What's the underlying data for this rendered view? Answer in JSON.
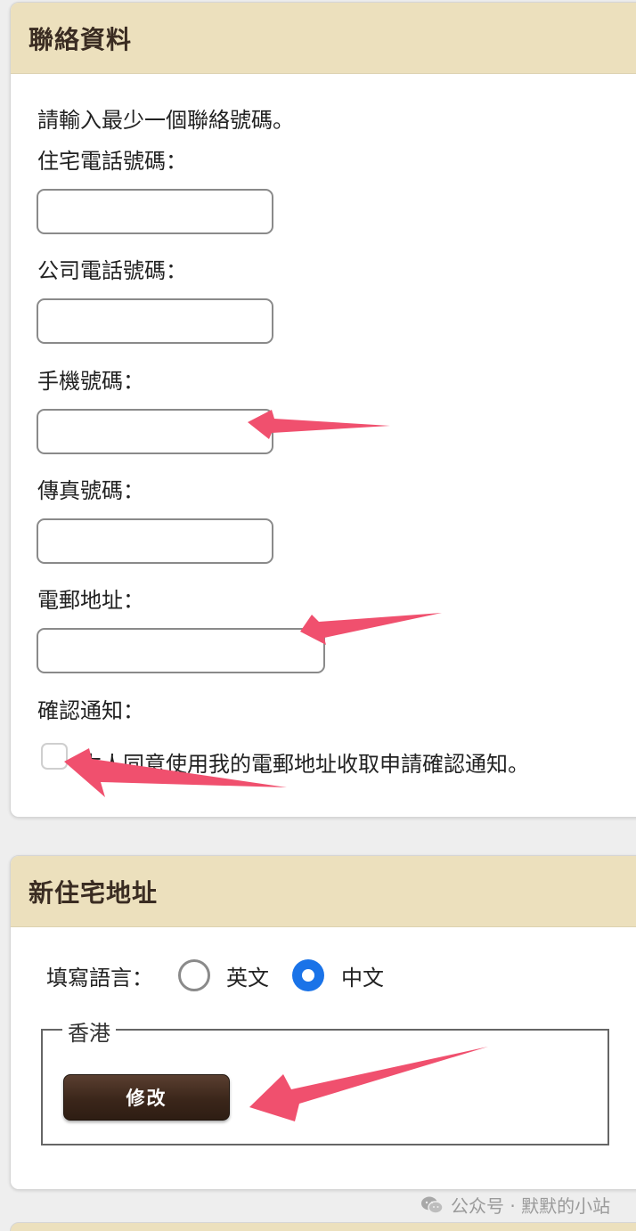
{
  "contact": {
    "title": "聯絡資料",
    "intro": "請輸入最少一個聯絡號碼。",
    "home_phone_label": "住宅電話號碼：",
    "home_phone_value": "",
    "office_phone_label": "公司電話號碼：",
    "office_phone_value": "",
    "mobile_label": "手機號碼：",
    "mobile_value": "",
    "fax_label": "傳真號碼：",
    "fax_value": "",
    "email_label": "電郵地址：",
    "email_value": "",
    "confirm_label": "確認通知：",
    "consent_text": "本人同意使用我的電郵地址收取申請確認通知。",
    "consent_checked": false
  },
  "address": {
    "title": "新住宅地址",
    "language_label": "填寫語言：",
    "language_options": [
      "英文",
      "中文"
    ],
    "language_selected": "中文",
    "region_legend": "香港",
    "edit_button": "修改"
  },
  "watermark": {
    "text": "公众号 · 默默的小站",
    "icon": "wechat-icon"
  },
  "colors": {
    "header_bg": "#ece0bd",
    "annotation_arrow": "#f0506e",
    "button_bg": "#3b261a",
    "radio_selected": "#1a73e8"
  }
}
